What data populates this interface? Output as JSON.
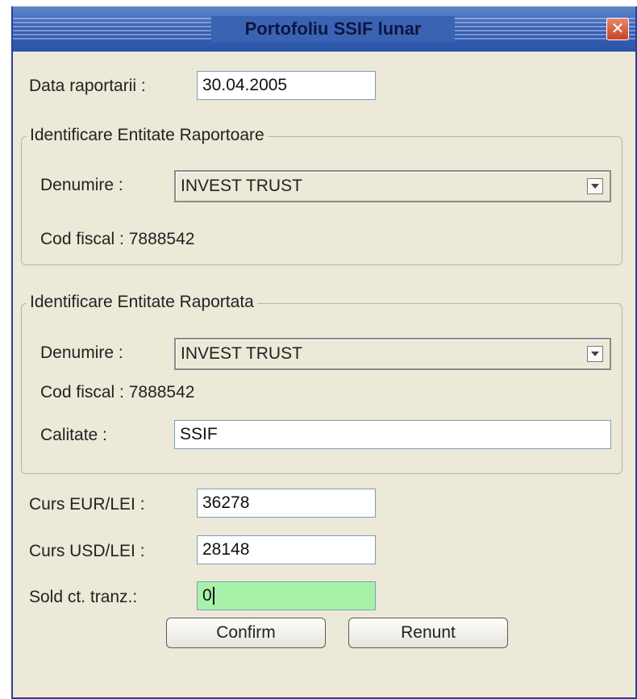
{
  "window": {
    "title": "Portofoliu SSIF lunar",
    "close_symbol": "✕"
  },
  "report": {
    "date_label": "Data raportarii :",
    "date_value": "30.04.2005"
  },
  "reporting_entity": {
    "legend": "Identificare Entitate Raportoare",
    "name_label": "Denumire :",
    "name_value": "INVEST TRUST",
    "fiscal_code": "Cod fiscal : 7888542"
  },
  "reported_entity": {
    "legend": "Identificare Entitate Raportata",
    "name_label": "Denumire :",
    "name_value": "INVEST TRUST",
    "fiscal_code": "Cod fiscal : 7888542",
    "quality_label": "Calitate :",
    "quality_value": "SSIF"
  },
  "rates": {
    "eur_label": "Curs EUR/LEI :",
    "eur_value": "36278",
    "usd_label": "Curs USD/LEI :",
    "usd_value": "28148",
    "balance_label": "Sold ct. tranz.:",
    "balance_value": "0"
  },
  "buttons": {
    "confirm": "Confirm",
    "cancel": "Renunt"
  },
  "colors": {
    "title_bar": "#3a63b8",
    "dialog_bg": "#ece9d8",
    "active_field": "#a7f2a8",
    "close_button": "#c9452a"
  },
  "icons": {
    "close": "close-icon",
    "dropdown": "chevron-down-icon"
  }
}
